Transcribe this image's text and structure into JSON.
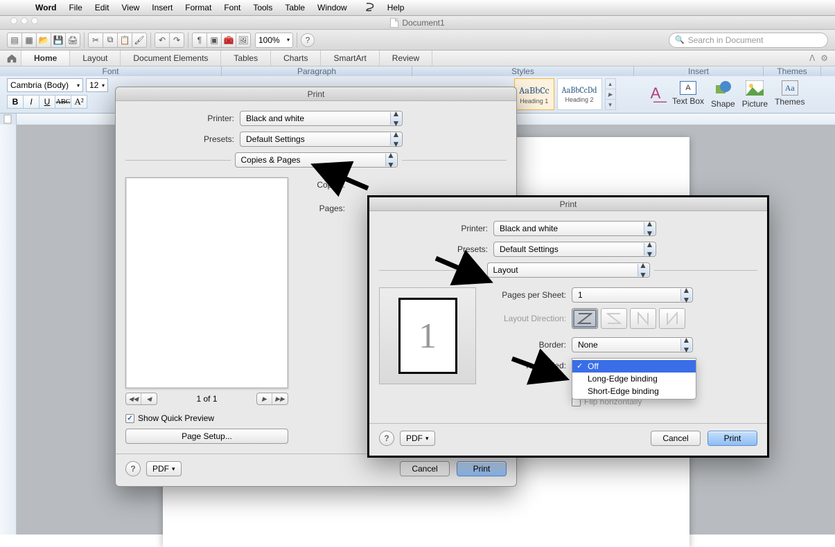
{
  "menu": {
    "app": "Word",
    "items": [
      "File",
      "Edit",
      "View",
      "Insert",
      "Format",
      "Font",
      "Tools",
      "Table",
      "Window"
    ],
    "help": "Help"
  },
  "doc_title": "Document1",
  "toolbar": {
    "zoom": "100%",
    "search_placeholder": "Search in Document"
  },
  "ribbon": {
    "tabs": [
      "Home",
      "Layout",
      "Document Elements",
      "Tables",
      "Charts",
      "SmartArt",
      "Review"
    ],
    "groups": {
      "font": "Font",
      "paragraph": "Paragraph",
      "styles": "Styles",
      "insert": "Insert",
      "themes": "Themes"
    },
    "font_name": "Cambria (Body)",
    "font_size": "12",
    "style_items": [
      {
        "preview": "AaBbCc",
        "label": "Heading 1",
        "selected": true
      },
      {
        "preview": "AaBbCcDd",
        "label": "Heading 2"
      }
    ],
    "insert_items": [
      "Text Box",
      "Shape",
      "Picture",
      "Themes"
    ]
  },
  "print1": {
    "title": "Print",
    "printer_label": "Printer:",
    "printer_value": "Black and white",
    "presets_label": "Presets:",
    "presets_value": "Default Settings",
    "panel_value": "Copies & Pages",
    "copies_label": "Copies:",
    "pages_label": "Pages:",
    "page_count": "1 of 1",
    "show_quick_preview": "Show Quick Preview",
    "page_setup": "Page Setup...",
    "pdf": "PDF",
    "cancel": "Cancel",
    "print": "Print"
  },
  "print2": {
    "title": "Print",
    "printer_label": "Printer:",
    "printer_value": "Black and white",
    "presets_label": "Presets:",
    "presets_value": "Default Settings",
    "panel_value": "Layout",
    "pps_label": "Pages per Sheet:",
    "pps_value": "1",
    "dir_label": "Layout Direction:",
    "border_label": "Border:",
    "border_value": "None",
    "two_sided_label": "Two-Sided:",
    "flip_label": "Flip horizontally",
    "pdf": "PDF",
    "cancel": "Cancel",
    "print": "Print",
    "dropdown": [
      "Off",
      "Long-Edge binding",
      "Short-Edge binding"
    ],
    "dropdown_selected": 0
  }
}
